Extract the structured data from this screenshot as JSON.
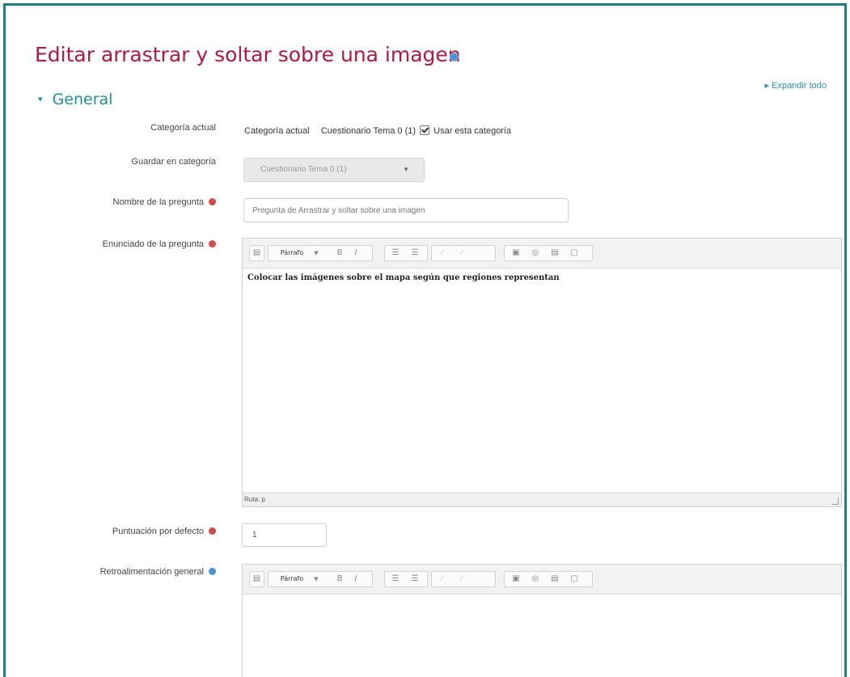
{
  "page": {
    "title": "Editar arrastrar y soltar sobre una imagen",
    "expand_all": "Expandir todo"
  },
  "section": {
    "title": "General"
  },
  "fields": {
    "categoria_actual": {
      "label": "Categoría actual",
      "text_1": "Categoría actual",
      "text_2": "Cuestionario Tema 0 (1)",
      "checkbox_label": "Usar esta categoría",
      "checkbox_checked": true
    },
    "guardar_en_categoria": {
      "label": "Guardar en categoría",
      "selected": "Cuestionario Tema 0 (1)"
    },
    "nombre_pregunta": {
      "label": "Nombre de la pregunta",
      "value": "Pregunta de Arrastrar y soltar sobre una imagen"
    },
    "enunciado": {
      "label": "Enunciado de la pregunta",
      "toolbar": {
        "format": "Párrafo",
        "bold": "B",
        "italic": "I"
      },
      "content": "Colocar las imágenes sobre el mapa según que regiones representan",
      "status": "Ruta: p"
    },
    "puntuacion": {
      "label": "Puntuación por defecto",
      "value": "1"
    },
    "retroalimentacion": {
      "label": "Retroalimentación general",
      "toolbar": {
        "format": "Párrafo",
        "bold": "B",
        "italic": "I"
      },
      "content": ""
    }
  },
  "colors": {
    "frame_border": "#1b7f84",
    "title": "#b0193a",
    "section": "#1f8f97",
    "required": "#d14b4b",
    "info": "#4d8fd1"
  }
}
